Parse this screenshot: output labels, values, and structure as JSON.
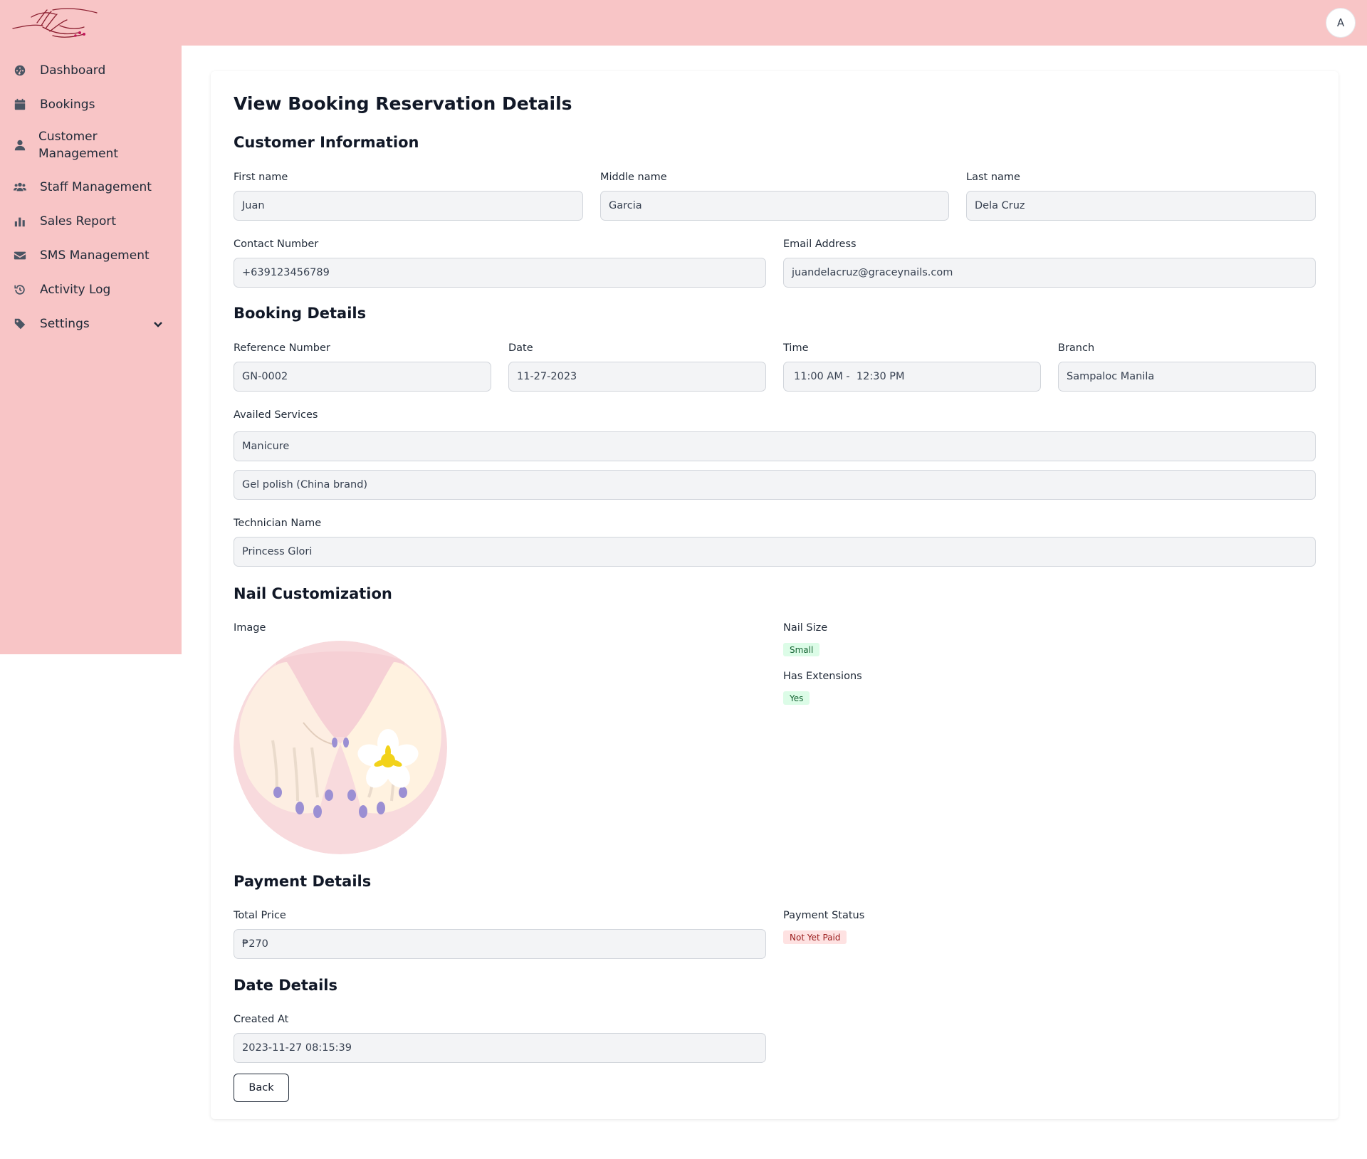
{
  "header": {
    "avatar_initial": "A"
  },
  "sidebar": {
    "items": [
      {
        "label": "Dashboard",
        "icon": "dashboard-icon"
      },
      {
        "label": "Bookings",
        "icon": "calendar-icon"
      },
      {
        "label": "Customer Management",
        "icon": "user-icon"
      },
      {
        "label": "Staff Management",
        "icon": "users-icon"
      },
      {
        "label": "Sales Report",
        "icon": "bar-chart-icon"
      },
      {
        "label": "SMS Management",
        "icon": "envelope-icon"
      },
      {
        "label": "Activity Log",
        "icon": "history-icon"
      },
      {
        "label": "Settings",
        "icon": "tag-icon"
      }
    ]
  },
  "page": {
    "title": "View Booking Reservation Details"
  },
  "customer": {
    "section_title": "Customer Information",
    "first_name_label": "First name",
    "first_name": "Juan",
    "middle_name_label": "Middle name",
    "middle_name": "Garcia",
    "last_name_label": "Last name",
    "last_name": "Dela Cruz",
    "contact_label": "Contact Number",
    "contact": "+639123456789",
    "email_label": "Email Address",
    "email": "juandelacruz@graceynails.com"
  },
  "booking": {
    "section_title": "Booking Details",
    "reference_label": "Reference Number",
    "reference": "GN-0002",
    "date_label": "Date",
    "date": "11-27-2023",
    "time_label": "Time",
    "time": "11:00 AM -  12:30 PM",
    "branch_label": "Branch",
    "branch": "Sampaloc Manila",
    "services_label": "Availed Services",
    "services": [
      "Manicure",
      "Gel polish (China brand)"
    ],
    "technician_label": "Technician Name",
    "technician": "Princess Glori"
  },
  "nail": {
    "section_title": "Nail Customization",
    "image_label": "Image",
    "size_label": "Nail Size",
    "size": "Small",
    "extensions_label": "Has Extensions",
    "extensions": "Yes"
  },
  "payment": {
    "section_title": "Payment Details",
    "total_label": "Total Price",
    "total": "₱270",
    "status_label": "Payment Status",
    "status": "Not Yet Paid"
  },
  "dates": {
    "section_title": "Date Details",
    "created_label": "Created At",
    "created": "2023-11-27 08:15:39"
  },
  "actions": {
    "back_label": "Back"
  },
  "colors": {
    "brand_pink": "#f8c5c6",
    "badge_green": "#dcfce7",
    "badge_red": "#fee2e2"
  }
}
